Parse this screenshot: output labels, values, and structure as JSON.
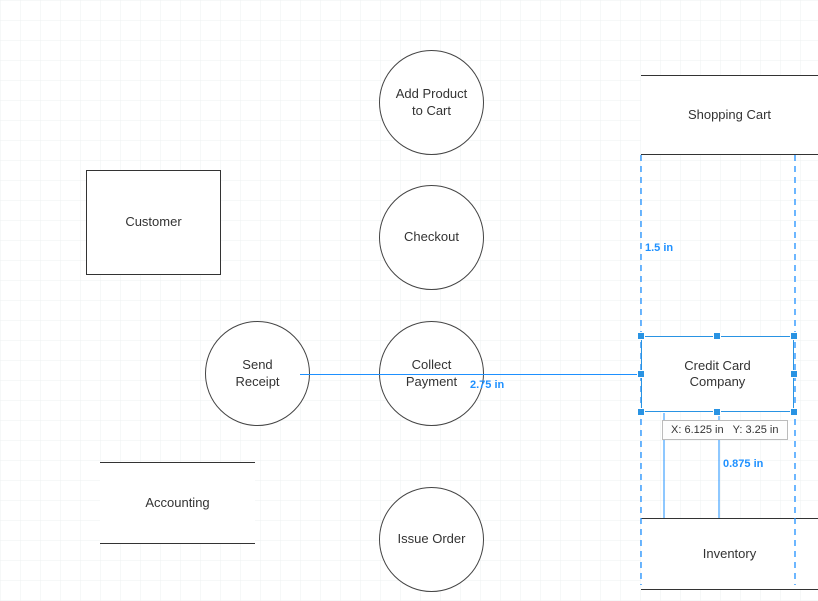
{
  "nodes": {
    "customer": {
      "label": "Customer"
    },
    "add_product": {
      "label": "Add Product\nto Cart"
    },
    "checkout": {
      "label": "Checkout"
    },
    "send_receipt": {
      "label": "Send\nReceipt"
    },
    "collect_payment": {
      "label": "Collect\nPayment"
    },
    "issue_order": {
      "label": "Issue Order"
    },
    "accounting": {
      "label": "Accounting"
    },
    "shopping_cart": {
      "label": "Shopping Cart"
    },
    "credit_card_company": {
      "label": "Credit Card\nCompany"
    },
    "inventory": {
      "label": "Inventory"
    }
  },
  "measurements": {
    "collect_to_cc": "2.75 in",
    "cart_to_cc": "1.5 in",
    "cc_to_inventory": "0.875 in"
  },
  "coord_tooltip": {
    "x_label": "X:",
    "x_value": "6.125 in",
    "y_label": "Y:",
    "y_value": "3.25 in"
  }
}
